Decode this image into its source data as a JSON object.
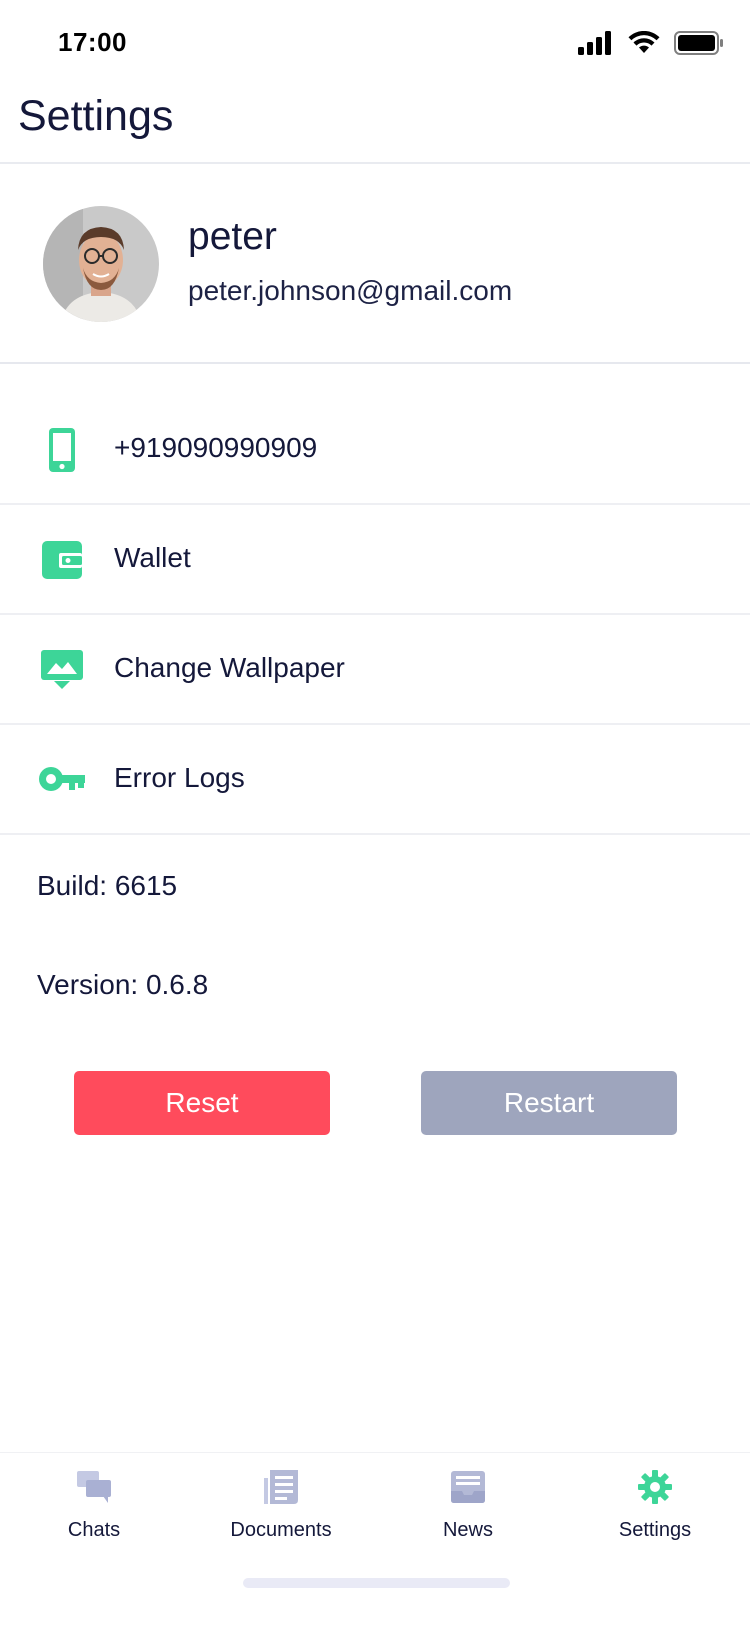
{
  "status_bar": {
    "time": "17:00",
    "icons": [
      "signal-icon",
      "wifi-icon",
      "battery-icon"
    ]
  },
  "header": {
    "title": "Settings"
  },
  "profile": {
    "name": "peter",
    "email": "peter.johnson@gmail.com"
  },
  "menu": {
    "items": [
      {
        "label": "+919090990909",
        "icon": "phone-icon"
      },
      {
        "label": "Wallet",
        "icon": "wallet-icon"
      },
      {
        "label": "Change Wallpaper",
        "icon": "wallpaper-icon"
      },
      {
        "label": "Error Logs",
        "icon": "key-icon"
      }
    ]
  },
  "info": {
    "build": "Build: 6615",
    "version": "Version: 0.6.8"
  },
  "buttons": {
    "reset": "Reset",
    "restart": "Restart"
  },
  "tabs": [
    {
      "label": "Chats",
      "icon": "chats-icon",
      "active": false
    },
    {
      "label": "Documents",
      "icon": "documents-icon",
      "active": false
    },
    {
      "label": "News",
      "icon": "news-icon",
      "active": false
    },
    {
      "label": "Settings",
      "icon": "settings-gear-icon",
      "active": true
    }
  ],
  "colors": {
    "accent": "#3dd598",
    "danger": "#ff4b5c",
    "muted_button": "#9ea5bd",
    "inactive_tab_icon": "#b3b9d6",
    "text": "#14183a"
  }
}
